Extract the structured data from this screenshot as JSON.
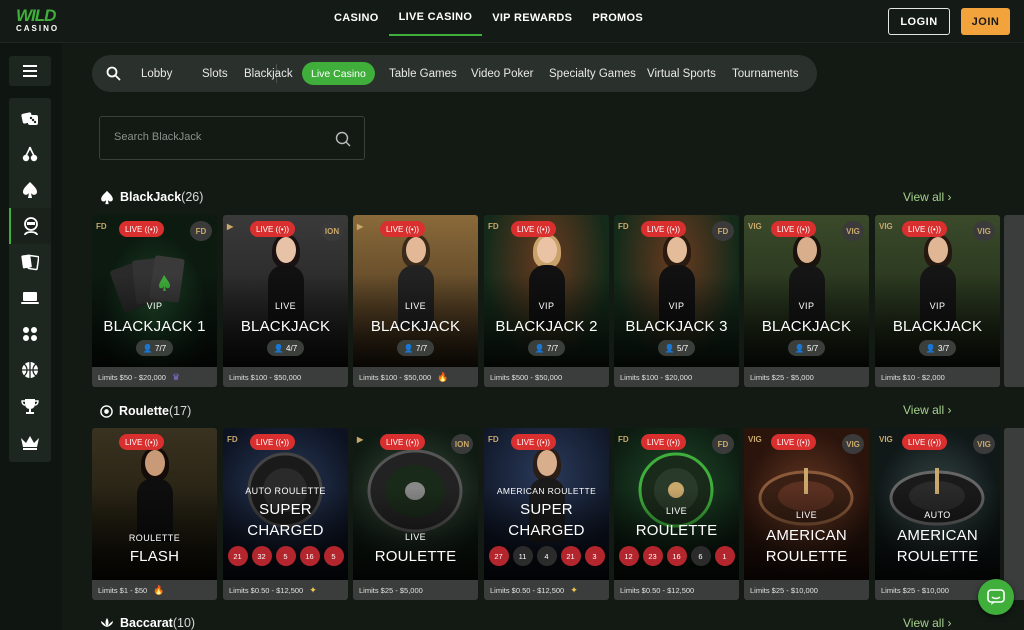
{
  "header": {
    "logo_top": "WILD",
    "logo_bottom": "CASINO",
    "nav": [
      "CASINO",
      "LIVE CASINO",
      "VIP REWARDS",
      "PROMOS"
    ],
    "active_nav": "LIVE CASINO",
    "login_label": "LOGIN",
    "join_label": "JOIN",
    "accent_color": "#3fae3b",
    "join_color": "#f2a33b"
  },
  "sidebar": {
    "menu_icon": "hamburger-icon",
    "icons": [
      "dice-icon",
      "cherries-icon",
      "spade-icon",
      "dealer-icon",
      "cards-icon",
      "laptop-icon",
      "dots-icon",
      "basketball-icon",
      "trophy-icon",
      "crown-icon"
    ],
    "active_icon": "dealer-icon"
  },
  "categories": {
    "search_icon": "search-icon",
    "items": [
      "Lobby",
      "Slots",
      "Blackjack",
      "Live Casino",
      "Table Games",
      "Video Poker",
      "Specialty Games",
      "Virtual Sports",
      "Tournaments"
    ],
    "active": "Live Casino"
  },
  "search": {
    "placeholder": "Search BlackJack"
  },
  "sections": [
    {
      "title": "BlackJack",
      "count": "(26)",
      "icon": "spade-icon",
      "view_all": "View all",
      "cards": [
        {
          "live": "LIVE",
          "provider_left": "FD",
          "provider_right": "FD",
          "sub": "VIP",
          "title": "BLACKJACK 1",
          "seats": "7/7",
          "limits": "Limits $50 - $20,000",
          "badge": "crown-badge-icon"
        },
        {
          "live": "LIVE",
          "provider_left": "▶",
          "provider_right": "ION",
          "sub": "LIVE",
          "title": "BLACKJACK",
          "seats": "4/7",
          "limits": "Limits $100 - $50,000",
          "badge": ""
        },
        {
          "live": "LIVE",
          "provider_left": "▶",
          "provider_right": "",
          "sub": "LIVE",
          "title": "BLACKJACK",
          "seats": "7/7",
          "limits": "Limits $100 - $50,000",
          "badge": "fire-icon"
        },
        {
          "live": "LIVE",
          "provider_left": "FD",
          "provider_right": "",
          "sub": "VIP",
          "title": "BLACKJACK 2",
          "seats": "7/7",
          "limits": "Limits $500 - $50,000",
          "badge": ""
        },
        {
          "live": "LIVE",
          "provider_left": "FD",
          "provider_right": "FD",
          "sub": "VIP",
          "title": "BLACKJACK 3",
          "seats": "5/7",
          "limits": "Limits $100 - $20,000",
          "badge": ""
        },
        {
          "live": "LIVE",
          "provider_left": "VIG",
          "provider_right": "VIG",
          "sub": "VIP",
          "title": "BLACKJACK",
          "seats": "5/7",
          "limits": "Limits $25 - $5,000",
          "badge": ""
        },
        {
          "live": "LIVE",
          "provider_left": "VIG",
          "provider_right": "VIG",
          "sub": "VIP",
          "title": "BLACKJACK",
          "seats": "3/7",
          "limits": "Limits $10 - $2,000",
          "badge": ""
        }
      ]
    },
    {
      "title": "Roulette",
      "count": "(17)",
      "icon": "roulette-icon",
      "view_all": "View all",
      "cards": [
        {
          "live": "LIVE",
          "provider_left": "",
          "provider_right": "",
          "sub": "ROULETTE",
          "title": "FLASH",
          "limits": "Limits $1 - $50",
          "badge": "fire-icon",
          "numbers": []
        },
        {
          "live": "LIVE",
          "provider_left": "FD",
          "provider_right": "",
          "sub": "AUTO ROULETTE",
          "title": "SUPER CHARGED",
          "limits": "Limits $0.50 - $12,500",
          "badge": "sparkle-icon",
          "numbers": [
            {
              "n": "21",
              "c": "r"
            },
            {
              "n": "32",
              "c": "r"
            },
            {
              "n": "5",
              "c": "r"
            },
            {
              "n": "16",
              "c": "r"
            },
            {
              "n": "5",
              "c": "r"
            }
          ]
        },
        {
          "live": "LIVE",
          "provider_left": "▶",
          "provider_right": "ION",
          "sub": "LIVE",
          "title": "ROULETTE",
          "limits": "Limits $25 - $5,000",
          "badge": "",
          "numbers": []
        },
        {
          "live": "LIVE",
          "provider_left": "FD",
          "provider_right": "",
          "sub": "AMERICAN ROULETTE",
          "title": "SUPER CHARGED",
          "limits": "Limits $0.50 - $12,500",
          "badge": "sparkle-icon",
          "numbers": [
            {
              "n": "27",
              "c": "r"
            },
            {
              "n": "11",
              "c": "b"
            },
            {
              "n": "4",
              "c": "b"
            },
            {
              "n": "21",
              "c": "r"
            },
            {
              "n": "3",
              "c": "r"
            }
          ]
        },
        {
          "live": "LIVE",
          "provider_left": "FD",
          "provider_right": "FD",
          "sub": "LIVE",
          "title": "ROULETTE",
          "limits": "Limits $0.50 - $12,500",
          "badge": "",
          "numbers": [
            {
              "n": "12",
              "c": "r"
            },
            {
              "n": "23",
              "c": "r"
            },
            {
              "n": "16",
              "c": "r"
            },
            {
              "n": "6",
              "c": "b"
            },
            {
              "n": "1",
              "c": "r"
            }
          ]
        },
        {
          "live": "LIVE",
          "provider_left": "VIG",
          "provider_right": "VIG",
          "sub": "LIVE",
          "title": "AMERICAN ROULETTE",
          "limits": "Limits $25 - $10,000",
          "badge": "",
          "numbers": []
        },
        {
          "live": "LIVE",
          "provider_left": "VIG",
          "provider_right": "VIG",
          "sub": "AUTO",
          "title": "AMERICAN ROULETTE",
          "limits": "Limits $25 - $10,000",
          "badge": "",
          "numbers": []
        }
      ]
    },
    {
      "title": "Baccarat",
      "count": "(10)",
      "icon": "lotus-icon",
      "view_all": "View all"
    }
  ],
  "chat_icon": "chat-icon"
}
